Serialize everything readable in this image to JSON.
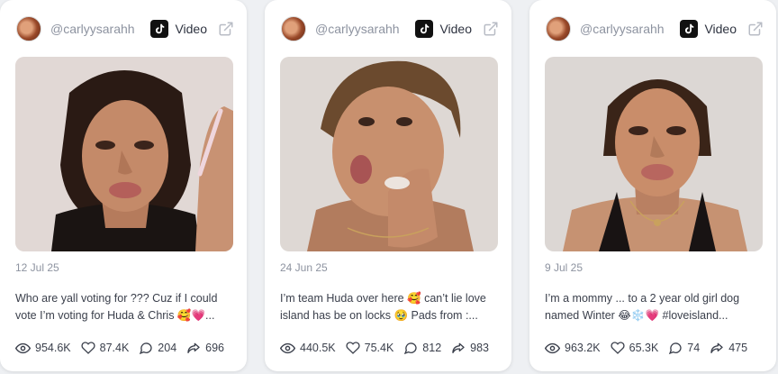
{
  "cards": [
    {
      "handle": "@carlyysarahh",
      "platform_label": "Video",
      "date": "12 Jul 25",
      "caption": "Who are yall voting for ??? Cuz if I could vote I’m voting for Huda & Chris 🥰💗...",
      "views": "954.6K",
      "likes": "87.4K",
      "comments": "204",
      "shares": "696"
    },
    {
      "handle": "@carlyysarahh",
      "platform_label": "Video",
      "date": "24 Jun 25",
      "caption": "I’m team Huda over here 🥰 can’t lie love island has be on locks 🥹 Pads from :...",
      "views": "440.5K",
      "likes": "75.4K",
      "comments": "812",
      "shares": "983"
    },
    {
      "handle": "@carlyysarahh",
      "platform_label": "Video",
      "date": "9 Jul 25",
      "caption": "I’m a mommy ... to a 2 year old girl dog named Winter 😂❄️💗 #loveisland...",
      "views": "963.2K",
      "likes": "65.3K",
      "comments": "74",
      "shares": "475"
    }
  ],
  "icons": {
    "platform": "tiktok-icon",
    "external": "external-link-icon",
    "views": "eye-icon",
    "likes": "heart-icon",
    "comments": "comment-icon",
    "shares": "share-icon"
  },
  "colors": {
    "page_background": "#eef0f3",
    "card_background": "#ffffff",
    "muted_text": "#8d93a0",
    "body_text": "#3a3f4b"
  }
}
